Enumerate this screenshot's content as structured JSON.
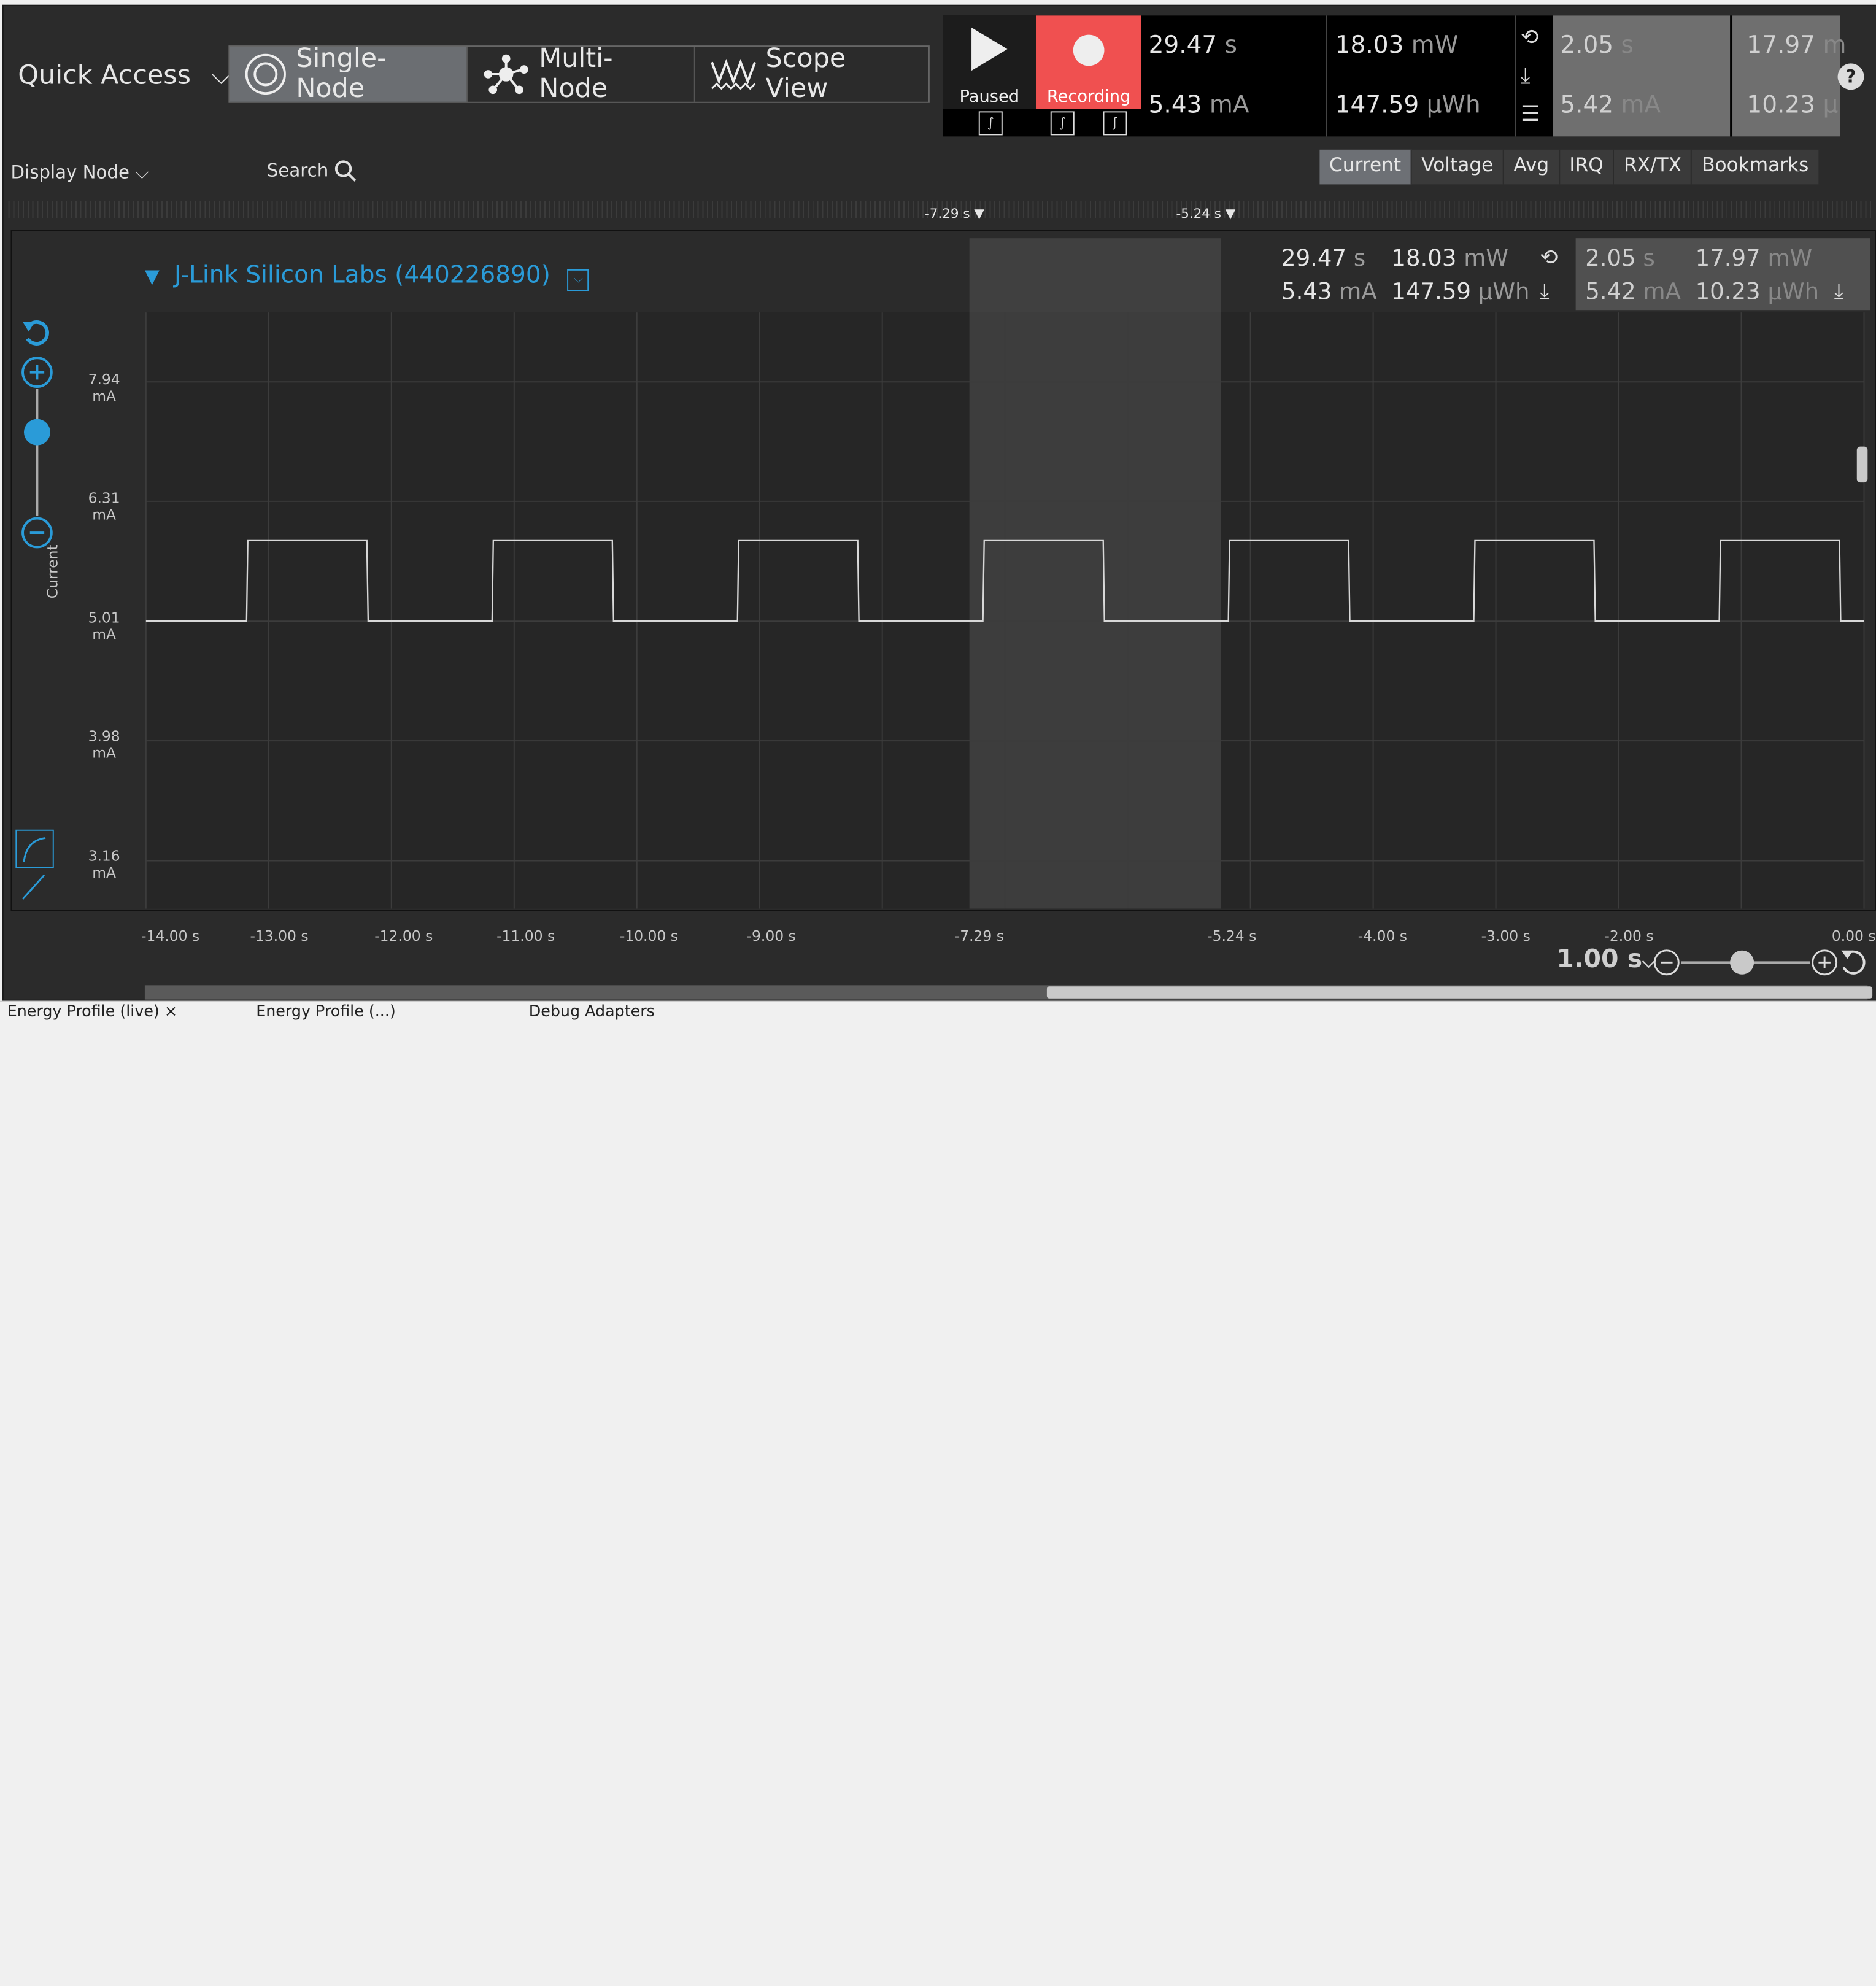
{
  "toolbar": {
    "quick_access": "Quick Access",
    "modes": [
      {
        "label": "Single-Node",
        "icon": "radio-circle-icon",
        "active": true
      },
      {
        "label": "Multi-Node",
        "icon": "network-nodes-icon",
        "active": false
      },
      {
        "label": "Scope View",
        "icon": "waveform-icon",
        "active": false
      }
    ]
  },
  "controls": {
    "paused_label": "Paused",
    "recording_label": "Recording",
    "recording_color": "#f05050",
    "total_time": "29.47",
    "total_time_unit": "s",
    "total_current": "5.43",
    "total_current_unit": "mA",
    "total_power": "18.03",
    "total_power_unit": "mW",
    "total_energy": "147.59",
    "total_energy_unit": "µWh",
    "sel_time": "2.05",
    "sel_time_unit": "s",
    "sel_current": "5.42",
    "sel_current_unit": "mA",
    "sel_power": "17.97",
    "sel_power_unit": "m",
    "sel_energy": "10.23",
    "sel_energy_unit": "µ"
  },
  "subbar": {
    "display_node": "Display Node",
    "search": "Search",
    "tabs": [
      {
        "label": "Current",
        "active": true
      },
      {
        "label": "Voltage",
        "active": false
      },
      {
        "label": "Avg",
        "active": false
      },
      {
        "label": "IRQ",
        "active": false
      },
      {
        "label": "RX/TX",
        "active": false
      },
      {
        "label": "Bookmarks",
        "active": false
      }
    ]
  },
  "cursors": {
    "left": "-7.29 s",
    "right": "-5.24 s"
  },
  "node": {
    "title": "J-Link Silicon Labs (440226890)",
    "accent": "#2a9bd8",
    "stats": {
      "time": "29.47",
      "time_unit": "s",
      "current": "5.43",
      "current_unit": "mA",
      "power": "18.03",
      "power_unit": "mW",
      "energy": "147.59",
      "energy_unit": "µWh",
      "sel_time": "2.05",
      "sel_time_unit": "s",
      "sel_current": "5.42",
      "sel_current_unit": "mA",
      "sel_power": "17.97",
      "sel_power_unit": "mW",
      "sel_energy": "10.23",
      "sel_energy_unit": "µWh"
    }
  },
  "y_axis": {
    "title": "Current",
    "ticks": [
      {
        "value": "7.94",
        "unit": "mA"
      },
      {
        "value": "6.31",
        "unit": "mA"
      },
      {
        "value": "5.01",
        "unit": "mA"
      },
      {
        "value": "3.98",
        "unit": "mA"
      },
      {
        "value": "3.16",
        "unit": "mA"
      }
    ]
  },
  "x_axis": {
    "ticks": [
      "-14.00 s",
      "-13.00 s",
      "-12.00 s",
      "-11.00 s",
      "-10.00 s",
      "-9.00 s",
      "-7.29 s",
      "-5.24 s",
      "-4.00 s",
      "-3.00 s",
      "-2.00 s",
      "0.00 s"
    ]
  },
  "zoom": {
    "duration": "1.00 s"
  },
  "bottom_tabs": [
    "Energy Profile (live) ×",
    "Energy Profile (...)",
    "Debug Adapters"
  ],
  "chart_data": {
    "type": "line",
    "xlabel": "",
    "ylabel": "Current",
    "ylim": [
      3.16,
      7.94
    ],
    "y_scale": "log",
    "xlim": [
      -14.0,
      0.0
    ],
    "x_unit": "s",
    "y_unit": "mA",
    "series": [
      {
        "x": [
          -14.0,
          -13.18,
          -13.17,
          -12.2,
          -12.19,
          -11.18,
          -11.17,
          -10.2,
          -10.19,
          -9.18,
          -9.17,
          -8.2,
          -8.19,
          -7.18,
          -7.17,
          -6.2,
          -6.19,
          -5.18,
          -5.17,
          -4.2,
          -4.19,
          -3.18,
          -3.17,
          -2.2,
          -2.19,
          -1.18,
          -1.17,
          -0.2,
          -0.19,
          0.0
        ],
        "y": [
          5.01,
          5.01,
          5.85,
          5.85,
          5.01,
          5.01,
          5.85,
          5.85,
          5.01,
          5.01,
          5.85,
          5.85,
          5.01,
          5.01,
          5.85,
          5.85,
          5.01,
          5.01,
          5.85,
          5.85,
          5.01,
          5.01,
          5.85,
          5.85,
          5.01,
          5.01,
          5.85,
          5.85,
          5.01,
          5.01
        ]
      }
    ],
    "selection": [
      -7.29,
      -5.24
    ],
    "grid": true
  }
}
